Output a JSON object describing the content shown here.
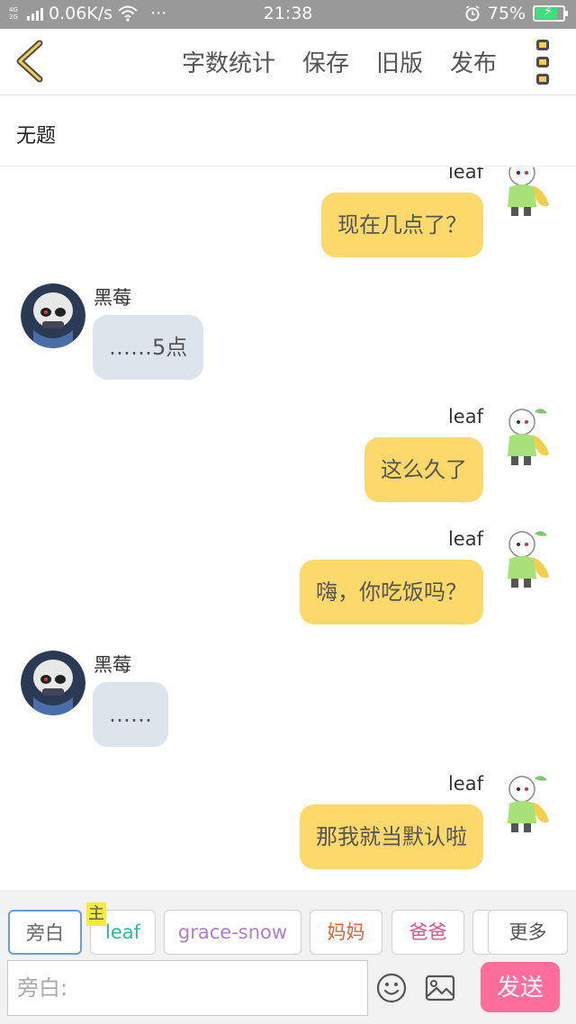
{
  "status_bar": {
    "network": "4G",
    "network2": "2G",
    "speed": "0.06K/s",
    "more": "···",
    "time": "21:38",
    "battery": "75%",
    "battery_level": 0.75
  },
  "toolbar": {
    "word_count": "字数统计",
    "save": "保存",
    "old_version": "旧版",
    "publish": "发布"
  },
  "story_title": "无题",
  "messages": [
    {
      "side": "right",
      "name": "leaf",
      "text": "现在几点了？"
    },
    {
      "side": "left",
      "name": "黑莓",
      "text": "……5点"
    },
    {
      "side": "right",
      "name": "leaf",
      "text": "这么久了"
    },
    {
      "side": "right",
      "name": "leaf",
      "text": "嗨，你吃饭吗？"
    },
    {
      "side": "left",
      "name": "黑莓",
      "text": "……"
    },
    {
      "side": "right",
      "name": "leaf",
      "text": "那我就当默认啦"
    }
  ],
  "roles": {
    "narrator": "旁白",
    "host_tag": "主",
    "items": [
      "leaf",
      "grace-snow",
      "妈妈",
      "爸爸"
    ],
    "more": "更多",
    "colors": {
      "leaf": "#2bb8a8",
      "grace-snow": "#b07cd0",
      "妈妈": "#e0603a",
      "爸爸": "#e0508a"
    }
  },
  "input": {
    "placeholder": "旁白:",
    "send": "发送"
  },
  "colors": {
    "my_bubble": "#fcd96a",
    "other_bubble": "#dde4ec",
    "send_button": "#ff6d9c",
    "status_bar": "#999999"
  }
}
